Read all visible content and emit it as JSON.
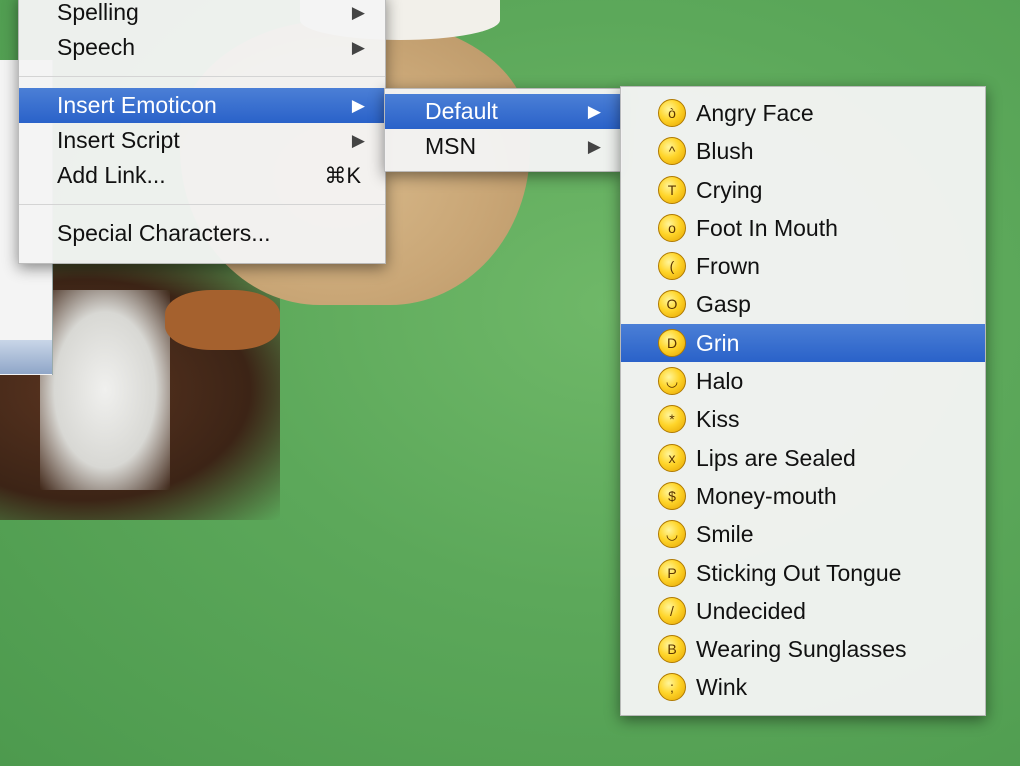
{
  "main_menu": {
    "items": [
      {
        "label": "Spelling",
        "submenu": true
      },
      {
        "label": "Speech",
        "submenu": true
      },
      {
        "label": "Insert Emoticon",
        "submenu": true,
        "selected": true
      },
      {
        "label": "Insert Script",
        "submenu": true
      },
      {
        "label": "Add Link...",
        "shortcut": "⌘K"
      },
      {
        "label": "Special Characters..."
      }
    ]
  },
  "sub_menu": {
    "items": [
      {
        "label": "Default",
        "selected": true
      },
      {
        "label": "MSN"
      }
    ]
  },
  "emoticon_menu": {
    "items": [
      {
        "label": "Angry Face",
        "icon": "angry-face-icon",
        "glyph": "ò"
      },
      {
        "label": "Blush",
        "icon": "blush-icon",
        "glyph": "^"
      },
      {
        "label": "Crying",
        "icon": "crying-icon",
        "glyph": "T"
      },
      {
        "label": "Foot In Mouth",
        "icon": "foot-in-mouth-icon",
        "glyph": "o"
      },
      {
        "label": "Frown",
        "icon": "frown-icon",
        "glyph": "("
      },
      {
        "label": "Gasp",
        "icon": "gasp-icon",
        "glyph": "O"
      },
      {
        "label": "Grin",
        "icon": "grin-icon",
        "glyph": "D",
        "selected": true
      },
      {
        "label": "Halo",
        "icon": "halo-icon",
        "glyph": "◡"
      },
      {
        "label": "Kiss",
        "icon": "kiss-icon",
        "glyph": "*"
      },
      {
        "label": "Lips are Sealed",
        "icon": "lips-sealed-icon",
        "glyph": "x"
      },
      {
        "label": "Money-mouth",
        "icon": "money-mouth-icon",
        "glyph": "$"
      },
      {
        "label": "Smile",
        "icon": "smile-icon",
        "glyph": "◡"
      },
      {
        "label": "Sticking Out Tongue",
        "icon": "tongue-icon",
        "glyph": "P"
      },
      {
        "label": "Undecided",
        "icon": "undecided-icon",
        "glyph": "/"
      },
      {
        "label": "Wearing Sunglasses",
        "icon": "sunglasses-icon",
        "glyph": "B"
      },
      {
        "label": "Wink",
        "icon": "wink-icon",
        "glyph": ";"
      }
    ]
  },
  "colors": {
    "selection": "#2a62c9",
    "menu_bg": "#f4f4f4",
    "desktop_green": "#5ca85a"
  }
}
